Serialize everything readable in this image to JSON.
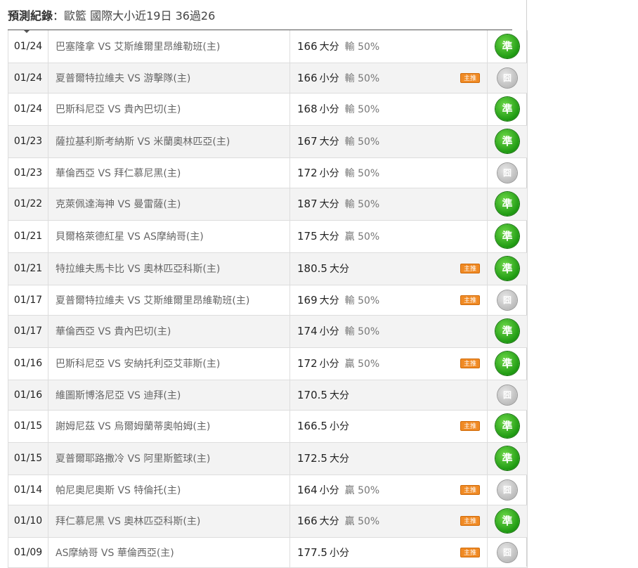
{
  "header": {
    "label": "預測紀錄",
    "separator": "：",
    "subtitle": "歐籃 國際大小近19日 36過26"
  },
  "colors": {
    "win": "#1f9a12",
    "lose": "#bdbdbd",
    "tag": "#f08a24"
  },
  "rows": [
    {
      "date": "01/24",
      "match": "巴塞隆拿 VS 艾斯維爾里昂維勒班(主)",
      "value": "166",
      "pick": "大分",
      "pct": "輸 50%",
      "tag": "",
      "result": "準",
      "status": "win"
    },
    {
      "date": "01/24",
      "match": "夏普爾特拉維夫 VS 游擊隊(主)",
      "value": "166",
      "pick": "小分",
      "pct": "輸 50%",
      "tag": "主推",
      "result": "囧",
      "status": "lose"
    },
    {
      "date": "01/24",
      "match": "巴斯科尼亞 VS 貴內巴切(主)",
      "value": "168",
      "pick": "小分",
      "pct": "輸 50%",
      "tag": "",
      "result": "準",
      "status": "win"
    },
    {
      "date": "01/23",
      "match": "薩拉基利斯考納斯 VS 米蘭奧林匹亞(主)",
      "value": "167",
      "pick": "大分",
      "pct": "輸 50%",
      "tag": "",
      "result": "準",
      "status": "win"
    },
    {
      "date": "01/23",
      "match": "華倫西亞 VS 拜仁慕尼黑(主)",
      "value": "172",
      "pick": "小分",
      "pct": "輸 50%",
      "tag": "",
      "result": "囧",
      "status": "lose"
    },
    {
      "date": "01/22",
      "match": "克萊佩達海神 VS 曼雷薩(主)",
      "value": "187",
      "pick": "大分",
      "pct": "輸 50%",
      "tag": "",
      "result": "準",
      "status": "win"
    },
    {
      "date": "01/21",
      "match": "貝爾格萊德紅星 VS AS摩納哥(主)",
      "value": "175",
      "pick": "大分",
      "pct": "贏 50%",
      "tag": "",
      "result": "準",
      "status": "win"
    },
    {
      "date": "01/21",
      "match": "特拉維夫馬卡比 VS 奧林匹亞科斯(主)",
      "value": "180.5",
      "pick": "大分",
      "pct": "",
      "tag": "主推",
      "result": "準",
      "status": "win"
    },
    {
      "date": "01/17",
      "match": "夏普爾特拉維夫 VS 艾斯維爾里昂維勒班(主)",
      "value": "169",
      "pick": "大分",
      "pct": "輸 50%",
      "tag": "主推",
      "result": "囧",
      "status": "lose"
    },
    {
      "date": "01/17",
      "match": "華倫西亞 VS 貴內巴切(主)",
      "value": "174",
      "pick": "小分",
      "pct": "輸 50%",
      "tag": "",
      "result": "準",
      "status": "win"
    },
    {
      "date": "01/16",
      "match": "巴斯科尼亞 VS 安納托利亞艾菲斯(主)",
      "value": "172",
      "pick": "小分",
      "pct": "贏 50%",
      "tag": "主推",
      "result": "準",
      "status": "win"
    },
    {
      "date": "01/16",
      "match": "維圖斯博洛尼亞 VS 迪拜(主)",
      "value": "170.5",
      "pick": "大分",
      "pct": "",
      "tag": "",
      "result": "囧",
      "status": "lose"
    },
    {
      "date": "01/15",
      "match": "謝姆尼茲 VS 烏爾姆蘭蒂奧帕姆(主)",
      "value": "166.5",
      "pick": "小分",
      "pct": "",
      "tag": "主推",
      "result": "準",
      "status": "win"
    },
    {
      "date": "01/15",
      "match": "夏普爾耶路撒冷 VS 阿里斯籃球(主)",
      "value": "172.5",
      "pick": "大分",
      "pct": "",
      "tag": "",
      "result": "準",
      "status": "win"
    },
    {
      "date": "01/14",
      "match": "帕尼奧尼奧斯 VS 特倫托(主)",
      "value": "164",
      "pick": "小分",
      "pct": "贏 50%",
      "tag": "主推",
      "result": "囧",
      "status": "lose"
    },
    {
      "date": "01/10",
      "match": "拜仁慕尼黑 VS 奧林匹亞科斯(主)",
      "value": "166",
      "pick": "大分",
      "pct": "贏 50%",
      "tag": "主推",
      "result": "準",
      "status": "win"
    },
    {
      "date": "01/09",
      "match": "AS摩納哥 VS 華倫西亞(主)",
      "value": "177.5",
      "pick": "小分",
      "pct": "",
      "tag": "主推",
      "result": "囧",
      "status": "lose"
    }
  ]
}
